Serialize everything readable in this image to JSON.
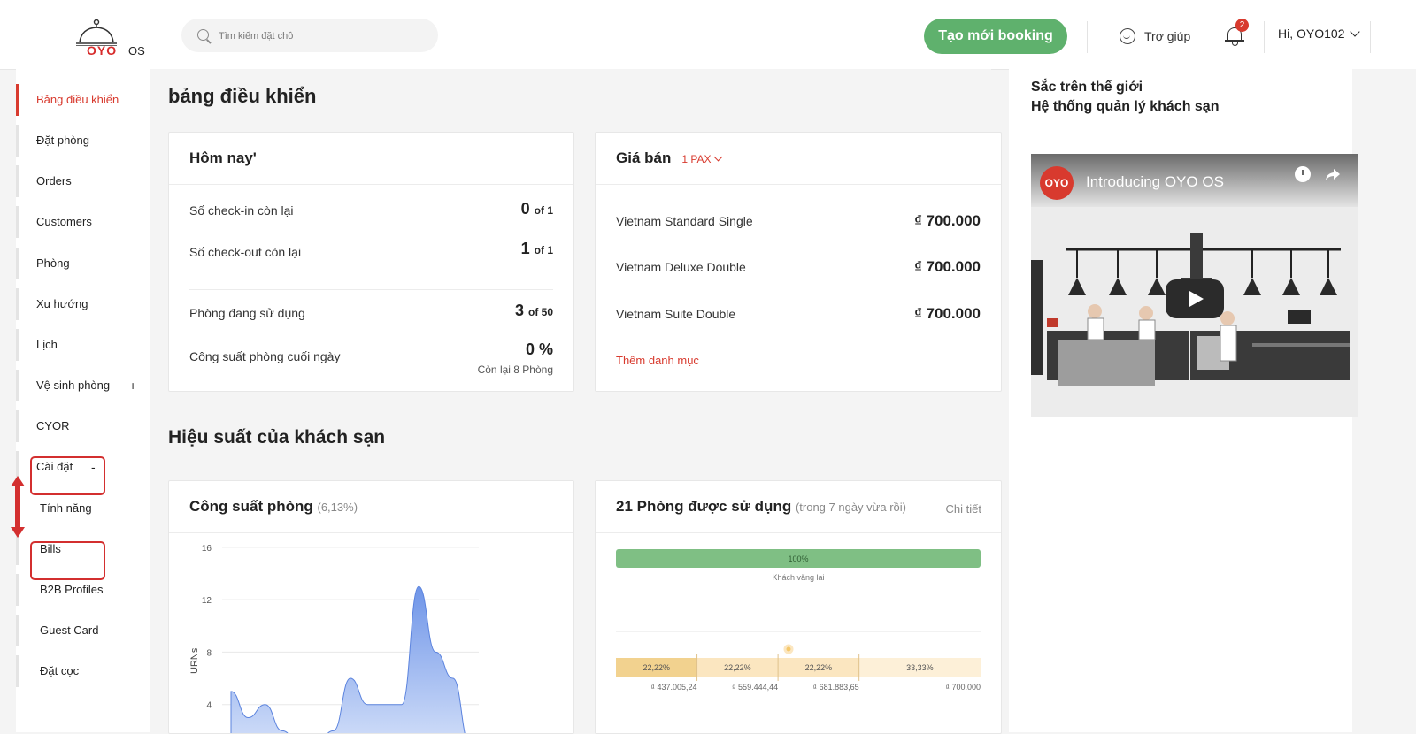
{
  "header": {
    "logo_word": "OYO",
    "logo_suffix": "OS",
    "search_placeholder": "Tìm kiếm đặt chỗ",
    "new_booking_label": "Tạo mới booking",
    "help_label": "Trợ giúp",
    "notification_count": "2",
    "user_greeting": "Hi, OYO102"
  },
  "sidebar": {
    "items": [
      {
        "label": "Bảng điều khiển"
      },
      {
        "label": "Đặt phòng"
      },
      {
        "label": "Orders"
      },
      {
        "label": "Customers"
      },
      {
        "label": "Phòng"
      },
      {
        "label": "Xu hướng"
      },
      {
        "label": "Lịch"
      },
      {
        "label": "Vệ sinh phòng",
        "toggle": "+"
      },
      {
        "label": "CYOR"
      },
      {
        "label": "Cài đặt",
        "toggle": "-"
      },
      {
        "label": "Tính năng"
      },
      {
        "label": "Bills"
      },
      {
        "label": "B2B Profiles"
      },
      {
        "label": "Guest Card"
      },
      {
        "label": "Đặt cọc"
      }
    ]
  },
  "main": {
    "page_title": "bảng điều khiển",
    "today": {
      "title": "Hôm nay'",
      "rows": [
        {
          "label": "Số check-in còn lại",
          "value": "0",
          "suffix": "of 1"
        },
        {
          "label": "Số check-out còn lại",
          "value": "1",
          "suffix": "of 1"
        },
        {
          "label": "Phòng đang sử dụng",
          "value": "3",
          "suffix": "of 50"
        },
        {
          "label": "Công suất phòng cuối ngày",
          "value": "0 %",
          "sub": "Còn lại 8 Phòng"
        }
      ]
    },
    "price": {
      "title": "Giá bán",
      "pax": "1 PAX",
      "rows": [
        {
          "label": "Vietnam Standard Single",
          "price": "₫ 700.000"
        },
        {
          "label": "Vietnam Deluxe Double",
          "price": "₫ 700.000"
        },
        {
          "label": "Vietnam Suite Double",
          "price": "₫ 700.000"
        }
      ],
      "add_category": "Thêm danh mục"
    },
    "section_title": "Hiệu suất của khách sạn",
    "occupancy": {
      "title": "Công suất phòng",
      "percent": "(6,13%)"
    },
    "rooms_used": {
      "title": "21 Phòng được sử dụng",
      "subtitle": "(trong 7 ngày vừa rồi)",
      "details": "Chi tiết",
      "bar_label": "100%",
      "bar_caption": "Khách vãng lai",
      "segments": [
        "22,22%",
        "22,22%",
        "22,22%",
        "33,33%"
      ],
      "prices": [
        "₫ 437.005,24",
        "₫ 559.444,44",
        "₫ 681.883,65",
        "₫ 700.000"
      ]
    }
  },
  "right_panel": {
    "line1": "Sắc trên thế giới",
    "line2": "Hệ thống quản lý khách sạn",
    "video_logo": "OYO",
    "video_title": "Introducing OYO OS"
  },
  "chart_data": [
    {
      "type": "area",
      "title": "Công suất phòng",
      "ylabel": "URNs",
      "yticks": [
        4,
        8,
        12,
        16
      ],
      "ylim": [
        0,
        17
      ],
      "values": [
        5,
        3,
        4,
        2,
        1,
        1,
        2,
        6,
        4,
        4,
        4,
        13,
        8,
        6,
        1
      ],
      "grid": true
    },
    {
      "type": "bar",
      "title": "21 Phòng được sử dụng",
      "series": [
        {
          "name": "Khách vãng lai",
          "values": [
            100
          ]
        }
      ],
      "price_segments": {
        "values": [
          22.22,
          22.22,
          22.22,
          33.33
        ],
        "prices": [
          "₫ 437.005,24",
          "₫ 559.444,44",
          "₫ 681.883,65",
          "₫ 700.000"
        ]
      },
      "colors": {
        "bar": "#7fbf84",
        "segments": [
          "#f2d28f",
          "#fbe6c0",
          "#fbe6c0",
          "#fdf0d8"
        ]
      }
    }
  ]
}
